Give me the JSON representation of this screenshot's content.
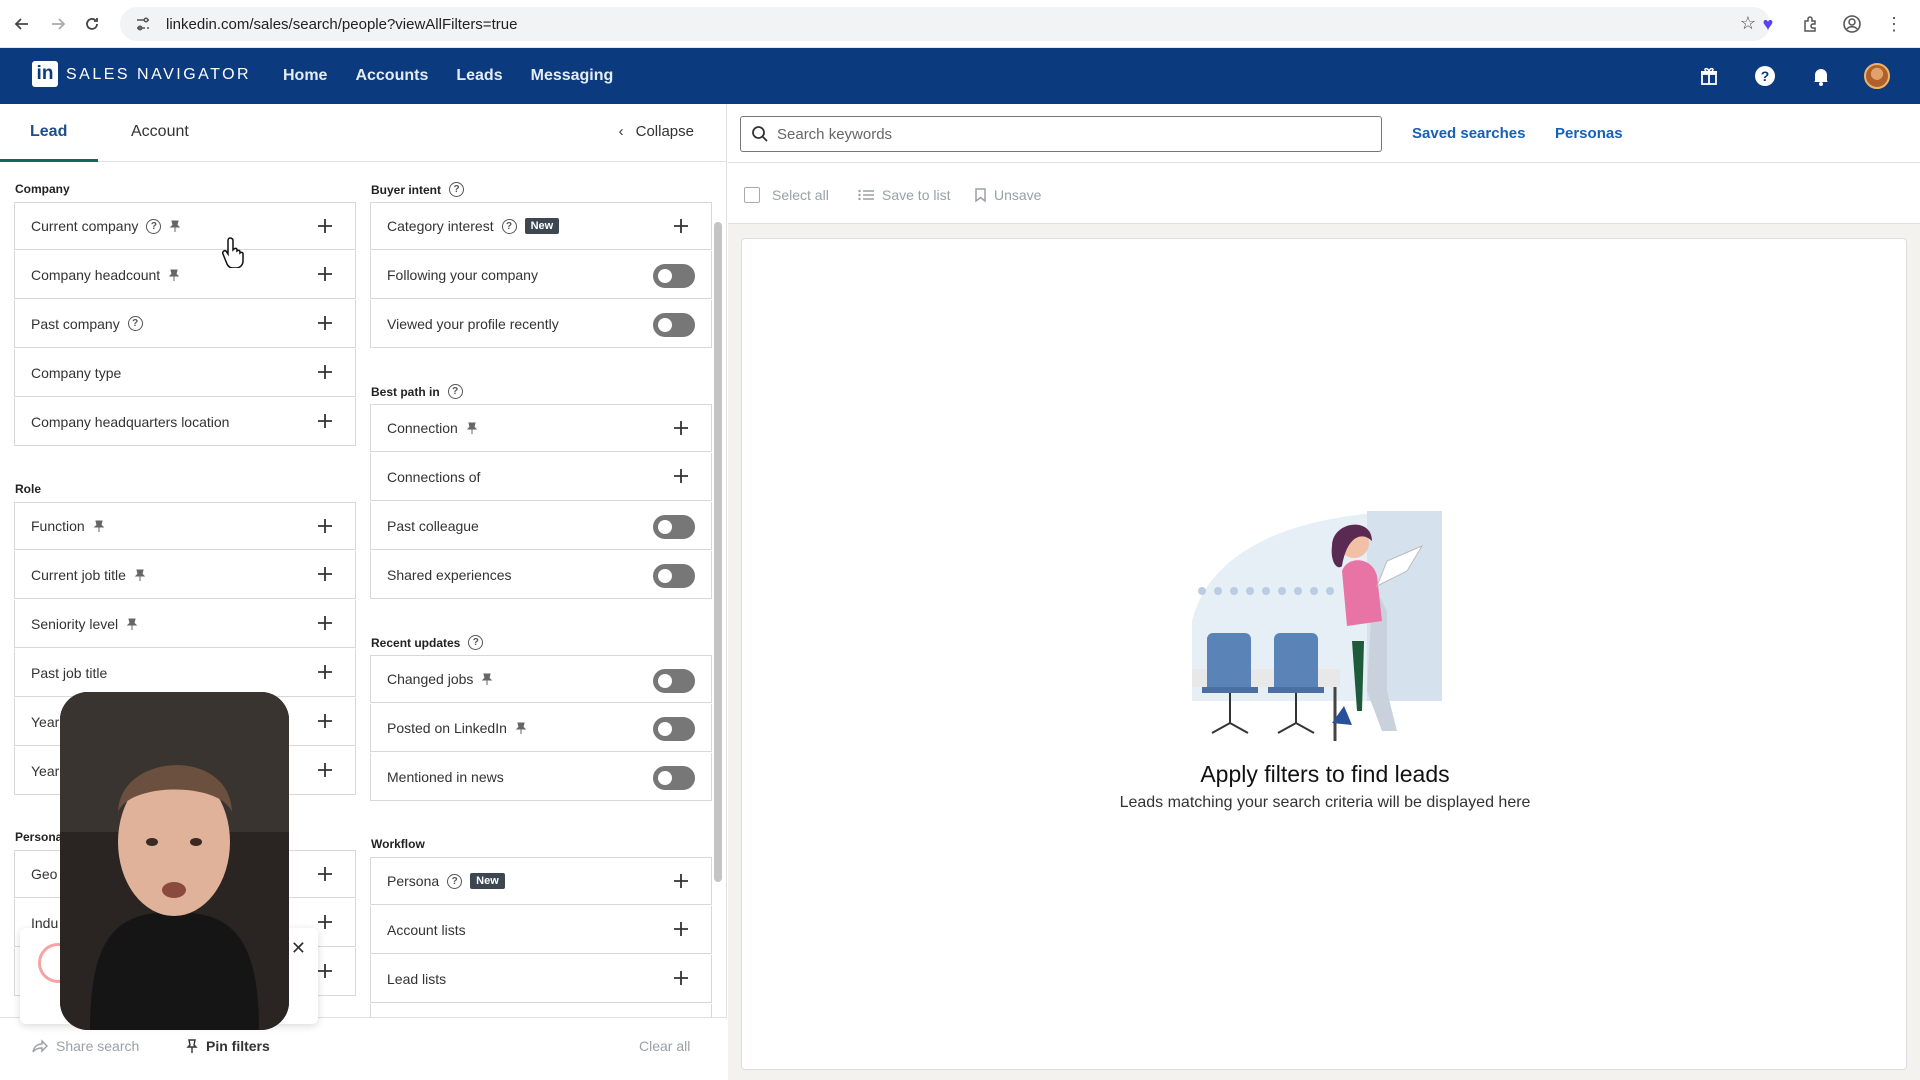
{
  "browser": {
    "url": "linkedin.com/sales/search/people?viewAllFilters=true"
  },
  "topnav": {
    "brand": "SALES NAVIGATOR",
    "links": [
      "Home",
      "Accounts",
      "Leads",
      "Messaging"
    ]
  },
  "left": {
    "tabs": [
      "Lead",
      "Account"
    ],
    "collapse": "Collapse",
    "sections": {
      "company": "Company",
      "role": "Role",
      "personal": "Persona",
      "buyer_intent": "Buyer intent",
      "best_path": "Best path in",
      "recent_updates": "Recent updates",
      "workflow": "Workflow"
    },
    "company_filters": [
      "Current company",
      "Company headcount",
      "Past company",
      "Company type",
      "Company headquarters location"
    ],
    "role_filters": [
      "Function",
      "Current job title",
      "Seniority level",
      "Past job title",
      "Year",
      "Year"
    ],
    "personal_filters": [
      "Geo",
      "Indu",
      ""
    ],
    "buyer_intent_filters": [
      "Category interest",
      "Following your company",
      "Viewed your profile recently"
    ],
    "best_path_filters": [
      "Connection",
      "Connections of",
      "Past colleague",
      "Shared experiences"
    ],
    "recent_updates_filters": [
      "Changed jobs",
      "Posted on LinkedIn",
      "Mentioned in news"
    ],
    "workflow_filters": [
      "Persona",
      "Account lists",
      "Lead lists"
    ],
    "new_badge": "New",
    "footer": {
      "share": "Share search",
      "pin": "Pin filters",
      "clear": "Clear all"
    }
  },
  "right": {
    "search_placeholder": "Search keywords",
    "saved_searches": "Saved searches",
    "personas": "Personas",
    "toolbar": {
      "select_all": "Select all",
      "save_to_list": "Save to list",
      "unsave": "Unsave"
    },
    "empty_title": "Apply filters to find leads",
    "empty_subtitle": "Leads matching your search criteria will be displayed here"
  },
  "colors": {
    "nav_bg": "#0b3a7e",
    "link": "#1760b4"
  }
}
